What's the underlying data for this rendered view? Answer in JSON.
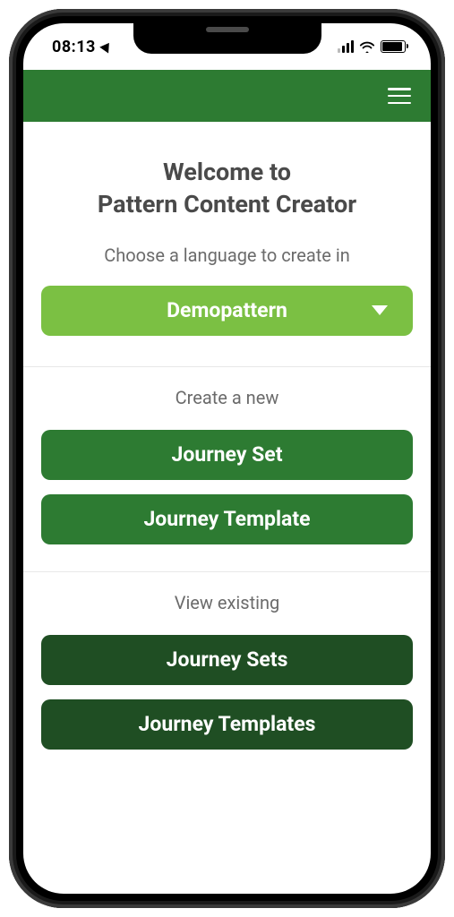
{
  "status": {
    "time": "08:13"
  },
  "welcome": {
    "title_line1": "Welcome to",
    "title_line2": "Pattern Content Creator",
    "choose_label": "Choose a language to create in",
    "dropdown_selected": "Demopattern"
  },
  "create": {
    "label": "Create a new",
    "journey_set": "Journey Set",
    "journey_template": "Journey Template"
  },
  "view": {
    "label": "View existing",
    "journey_sets": "Journey Sets",
    "journey_templates": "Journey Templates"
  }
}
